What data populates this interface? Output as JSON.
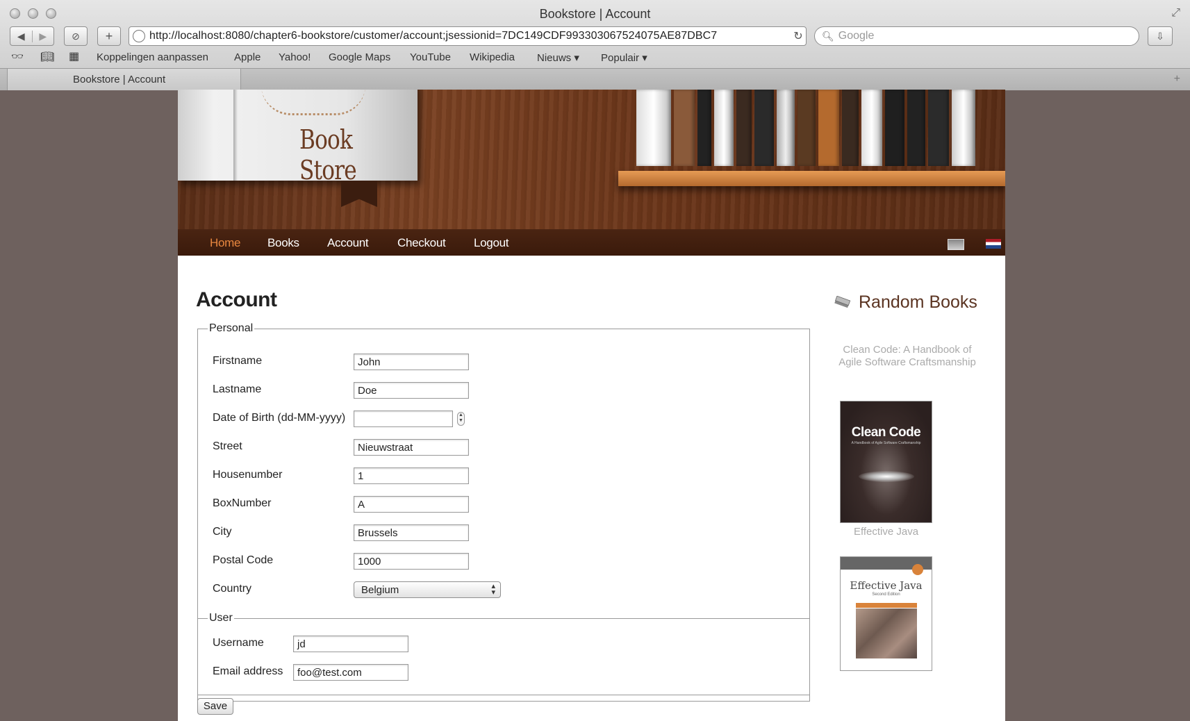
{
  "browser": {
    "window_title": "Bookstore | Account",
    "url": "http://localhost:8080/chapter6-bookstore/customer/account;jsessionid=7DC149CDF993303067524075AE87DBC7",
    "search_placeholder": "Google",
    "bookmarks": [
      "Koppelingen aanpassen",
      "Apple",
      "Yahoo!",
      "Google Maps",
      "YouTube",
      "Wikipedia",
      "Nieuws ▾",
      "Populair ▾"
    ],
    "tab_title": "Bookstore | Account"
  },
  "header": {
    "logo_text": "Book Store"
  },
  "nav": {
    "items": [
      "Home",
      "Books",
      "Account",
      "Checkout",
      "Logout"
    ],
    "active": "Home"
  },
  "main": {
    "title": "Account",
    "personal": {
      "legend": "Personal",
      "fields": [
        {
          "label": "Firstname",
          "value": "John"
        },
        {
          "label": "Lastname",
          "value": "Doe"
        },
        {
          "label": "Date of Birth (dd-MM-yyyy)",
          "value": ""
        },
        {
          "label": "Street",
          "value": "Nieuwstraat"
        },
        {
          "label": "Housenumber",
          "value": "1"
        },
        {
          "label": "BoxNumber",
          "value": "A"
        },
        {
          "label": "City",
          "value": "Brussels"
        },
        {
          "label": "Postal Code",
          "value": "1000"
        },
        {
          "label": "Country",
          "value": "Belgium"
        }
      ]
    },
    "user": {
      "legend": "User",
      "fields": [
        {
          "label": "Username",
          "value": "jd"
        },
        {
          "label": "Email address",
          "value": "foo@test.com"
        }
      ]
    },
    "save_label": "Save"
  },
  "sidebar": {
    "title": "Random Books",
    "book1_title": "Clean Code: A Handbook of Agile Software Craftsmanship",
    "book1_cover_title": "Clean Code",
    "book1_cover_subtitle": "A Handbook of Agile Software Craftsmanship",
    "book2_title": "Effective Java",
    "book2_cover_title": "Effective Java",
    "book2_cover_subtitle": "Second Edition"
  }
}
